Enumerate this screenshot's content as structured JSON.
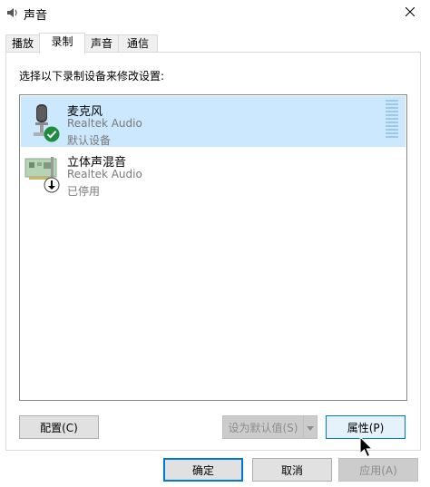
{
  "window": {
    "title": "声音"
  },
  "tabs": [
    {
      "label": "播放"
    },
    {
      "label": "录制"
    },
    {
      "label": "声音"
    },
    {
      "label": "通信"
    }
  ],
  "instruction": "选择以下录制设备来修改设置:",
  "devices": [
    {
      "name": "麦克风",
      "driver": "Realtek Audio",
      "status": "默认设备",
      "icon": "microphone-icon",
      "badge": "checkmark-icon"
    },
    {
      "name": "立体声混音",
      "driver": "Realtek Audio",
      "status": "已停用",
      "icon": "sound-card-icon",
      "badge": "down-arrow-icon"
    }
  ],
  "buttons": {
    "configure": "配置(C)",
    "set_default": "设为默认值(S)",
    "properties": "属性(P)",
    "ok": "确定",
    "cancel": "取消",
    "apply": "应用(A)"
  },
  "colors": {
    "selection": "#cce8ff",
    "accent": "#0078d7",
    "check": "#1e8e3e"
  }
}
